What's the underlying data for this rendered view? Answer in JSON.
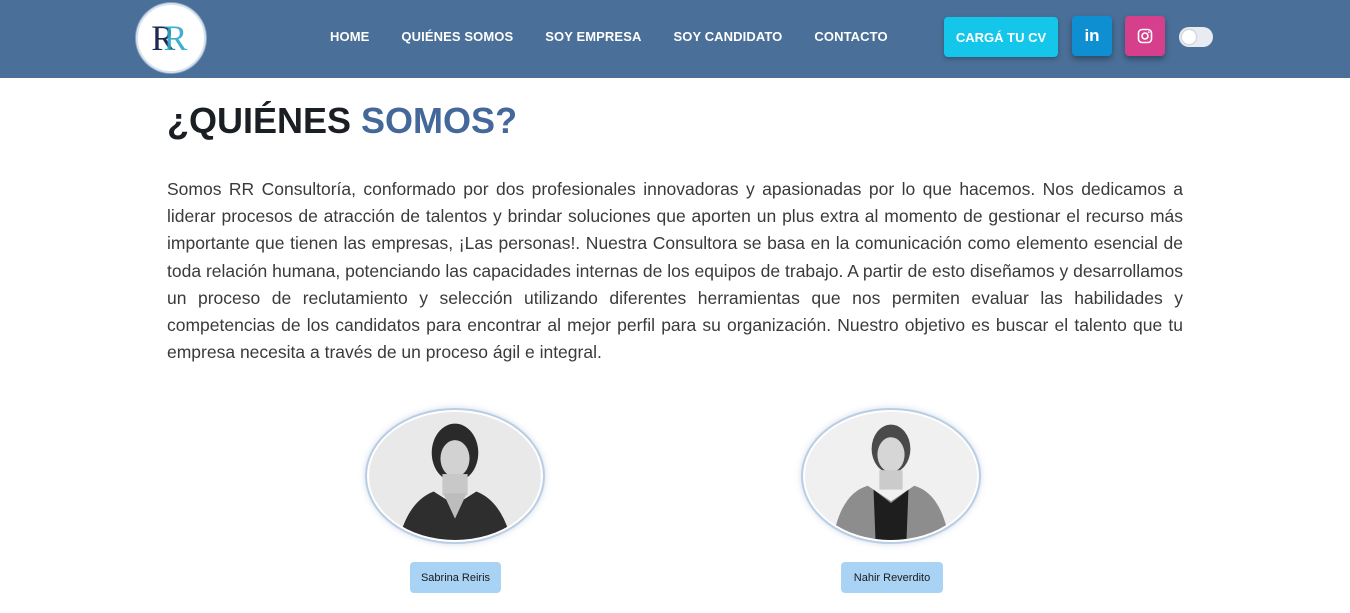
{
  "header": {
    "logo_text": "RR",
    "nav": [
      {
        "label": "HOME"
      },
      {
        "label": "QUIÉNES SOMOS"
      },
      {
        "label": "SOY EMPRESA"
      },
      {
        "label": "SOY CANDIDATO"
      },
      {
        "label": "CONTACTO"
      }
    ],
    "cv_button": "CARGÁ TU CV",
    "linkedin_icon": "linkedin-icon",
    "instagram_icon": "instagram-icon",
    "theme_toggle": "off"
  },
  "about": {
    "title_main": "¿QUIÉNES",
    "title_accent": "SOMOS?",
    "paragraph": "Somos RR Consultoría, conformado por dos profesionales innovadoras y apasionadas por lo que hacemos. Nos dedicamos a liderar procesos de atracción de talentos y brindar soluciones que aporten un plus extra al momento de gestionar el recurso más importante que tienen las empresas, ¡Las personas!. Nuestra Consultora se basa en la comunicación como elemento esencial de toda relación humana, potenciando las capacidades internas de los equipos de trabajo. A partir de esto diseñamos y desarrollamos un proceso de reclutamiento y selección utilizando diferentes herramientas que nos permiten evaluar las habilidades y competencias de los candidatos para encontrar al mejor perfil para su organización. Nuestro objetivo es buscar el talento que tu empresa necesita a través de un proceso ágil e integral."
  },
  "team": [
    {
      "name": "Sabrina Reiris"
    },
    {
      "name": "Nahir Reverdito"
    }
  ],
  "colors": {
    "navbar": "#4a6f98",
    "accent": "#44689a",
    "cv_button": "#13c6ea",
    "linkedin": "#0e8fd2",
    "instagram": "#d53f8c",
    "name_badge": "#a9d3f5"
  }
}
